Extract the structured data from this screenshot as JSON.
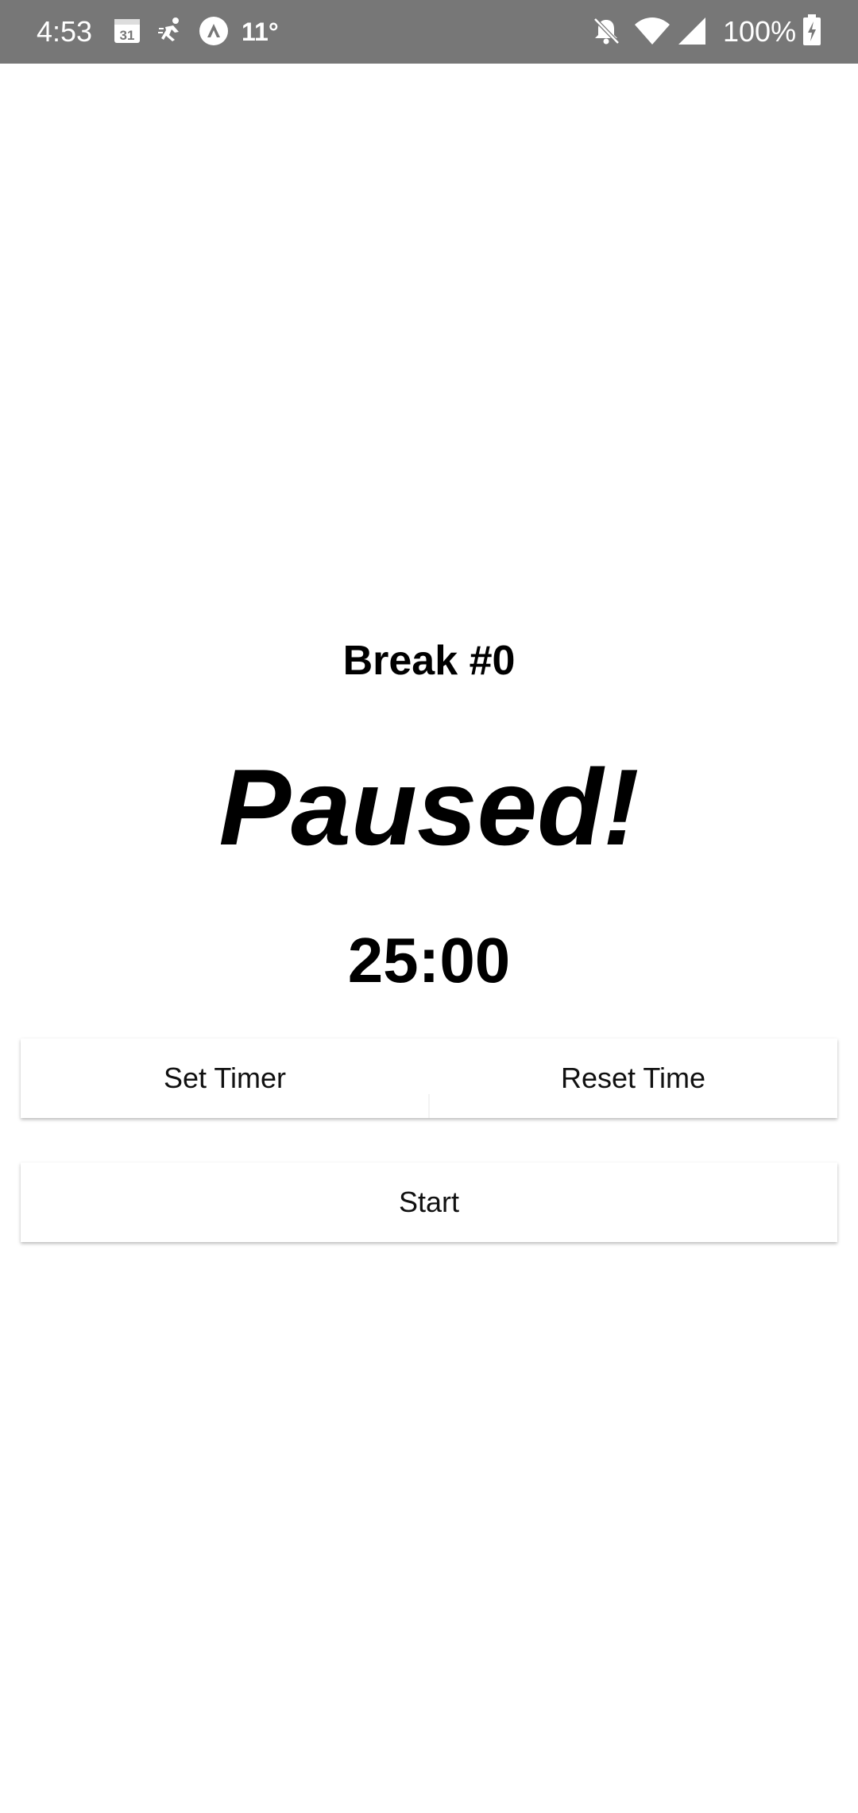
{
  "status_bar": {
    "time": "4:53",
    "calendar_day": "31",
    "temperature": "11°",
    "battery": "100%",
    "icons": [
      "calendar-icon",
      "activity-icon",
      "app-icon",
      "mute-icon",
      "wifi-icon",
      "signal-icon",
      "battery-charging-icon"
    ]
  },
  "timer": {
    "title": "Break #0",
    "status": "Paused!",
    "time": "25:00"
  },
  "buttons": {
    "set_timer": "Set Timer",
    "reset_time": "Reset Time",
    "start": "Start"
  }
}
